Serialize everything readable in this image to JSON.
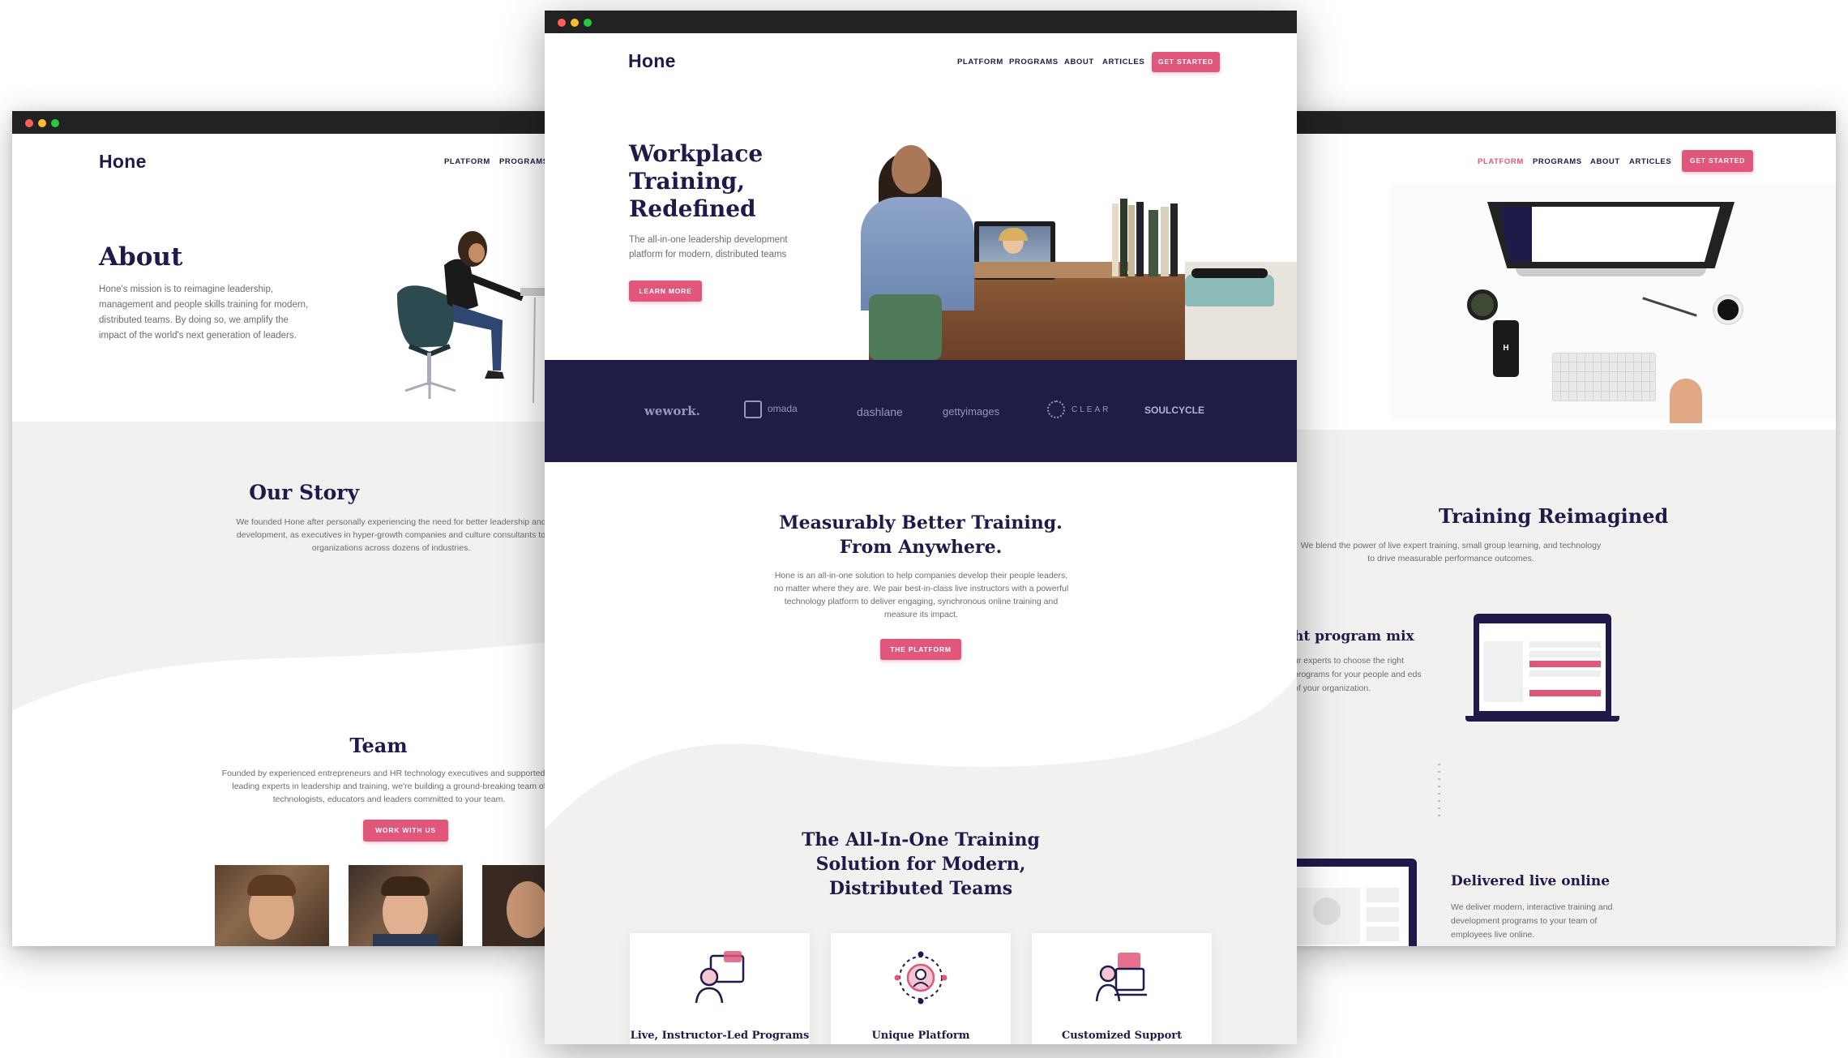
{
  "about_page": {
    "logo": "Hone",
    "nav": [
      "PLATFORM",
      "PROGRAMS"
    ],
    "hero_title": "About",
    "hero_text": "Hone's mission is to reimagine leadership, management and people skills training for modern, distributed teams. By doing so, we amplify the impact of the world's next generation of leaders.",
    "story_title": "Our Story",
    "story_text": "We founded Hone after personally experiencing the need for better leadership and development, as executives in hyper-growth companies and culture consultants to organizations across dozens of industries.",
    "team_title": "Team",
    "team_text": "Founded by experienced entrepreneurs and HR technology executives and supported by leading experts in leadership and training, we're building a ground-breaking team of technologists, educators and leaders committed to your team.",
    "team_button": "WORK WITH US"
  },
  "home_page": {
    "logo": "Hone",
    "nav": [
      "PLATFORM",
      "PROGRAMS",
      "ABOUT",
      "ARTICLES"
    ],
    "cta": "GET STARTED",
    "hero_title_lines": [
      "Workplace",
      "Training,",
      "Redefined"
    ],
    "hero_text": "The all-in-one leadership development platform for modern, distributed teams",
    "hero_button": "LEARN MORE",
    "client_logos": [
      "wework.",
      "omada",
      "dashlane",
      "gettyimages",
      "CLEAR",
      "SOULCYCLE"
    ],
    "section2_title_lines": [
      "Measurably Better Training.",
      "From Anywhere."
    ],
    "section2_text": "Hone is an all-in-one solution to help companies develop their people leaders, no matter where they are. We pair best-in-class live instructors with a powerful technology platform to deliver engaging, synchronous online training and measure its impact.",
    "section2_button": "THE PLATFORM",
    "section3_title_lines": [
      "The All-In-One Training",
      "Solution for Modern,",
      "Distributed Teams"
    ],
    "features": [
      "Live, Instructor-Led Programs",
      "Unique Platform",
      "Customized Support"
    ]
  },
  "platform_page": {
    "nav": [
      "PLATFORM",
      "PROGRAMS",
      "ABOUT",
      "ARTICLES"
    ],
    "cta": "GET STARTED",
    "device_logo": "H",
    "section_title": "Training Reimagined",
    "section_text": "We blend the power of live expert training, small group learning, and technology to drive measurable performance outcomes.",
    "feature1_title": "ht program mix",
    "feature1_text": "ur experts to choose the right programs for your people and eds of your organization.",
    "feature2_title": "Delivered live online",
    "feature2_text": "We deliver modern, interactive training and development programs to your team of employees live online."
  },
  "colors": {
    "navy": "#1e1b4b",
    "accent": "#e0577b",
    "section_gray": "#f2f1f0"
  }
}
